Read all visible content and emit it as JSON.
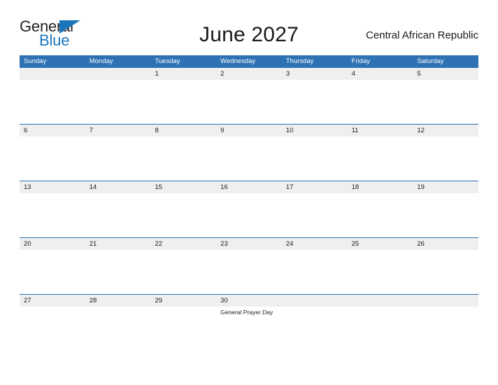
{
  "brand": {
    "name_part1": "General",
    "name_part2": "Blue",
    "flag_icon": "triangle-flag-icon",
    "accent_color": "#1b75bb"
  },
  "header": {
    "title": "June 2027",
    "country": "Central African Republic"
  },
  "theme": {
    "header_blue": "#2e72b4",
    "band_gray": "#efefef",
    "text_dark": "#1a1a1a",
    "text_white": "#ffffff"
  },
  "calendar": {
    "month": "June",
    "year": "2027",
    "weekday_headers": [
      "Sunday",
      "Monday",
      "Tuesday",
      "Wednesday",
      "Thursday",
      "Friday",
      "Saturday"
    ],
    "weeks": [
      {
        "days": [
          {
            "num": "",
            "events": []
          },
          {
            "num": "",
            "events": []
          },
          {
            "num": "1",
            "events": []
          },
          {
            "num": "2",
            "events": []
          },
          {
            "num": "3",
            "events": []
          },
          {
            "num": "4",
            "events": []
          },
          {
            "num": "5",
            "events": []
          }
        ]
      },
      {
        "days": [
          {
            "num": "6",
            "events": []
          },
          {
            "num": "7",
            "events": []
          },
          {
            "num": "8",
            "events": []
          },
          {
            "num": "9",
            "events": []
          },
          {
            "num": "10",
            "events": []
          },
          {
            "num": "11",
            "events": []
          },
          {
            "num": "12",
            "events": []
          }
        ]
      },
      {
        "days": [
          {
            "num": "13",
            "events": []
          },
          {
            "num": "14",
            "events": []
          },
          {
            "num": "15",
            "events": []
          },
          {
            "num": "16",
            "events": []
          },
          {
            "num": "17",
            "events": []
          },
          {
            "num": "18",
            "events": []
          },
          {
            "num": "19",
            "events": []
          }
        ]
      },
      {
        "days": [
          {
            "num": "20",
            "events": []
          },
          {
            "num": "21",
            "events": []
          },
          {
            "num": "22",
            "events": []
          },
          {
            "num": "23",
            "events": []
          },
          {
            "num": "24",
            "events": []
          },
          {
            "num": "25",
            "events": []
          },
          {
            "num": "26",
            "events": []
          }
        ]
      },
      {
        "days": [
          {
            "num": "27",
            "events": []
          },
          {
            "num": "28",
            "events": []
          },
          {
            "num": "29",
            "events": []
          },
          {
            "num": "30",
            "events": [
              "General Prayer Day"
            ]
          },
          {
            "num": "",
            "events": []
          },
          {
            "num": "",
            "events": []
          },
          {
            "num": "",
            "events": []
          }
        ]
      }
    ]
  }
}
